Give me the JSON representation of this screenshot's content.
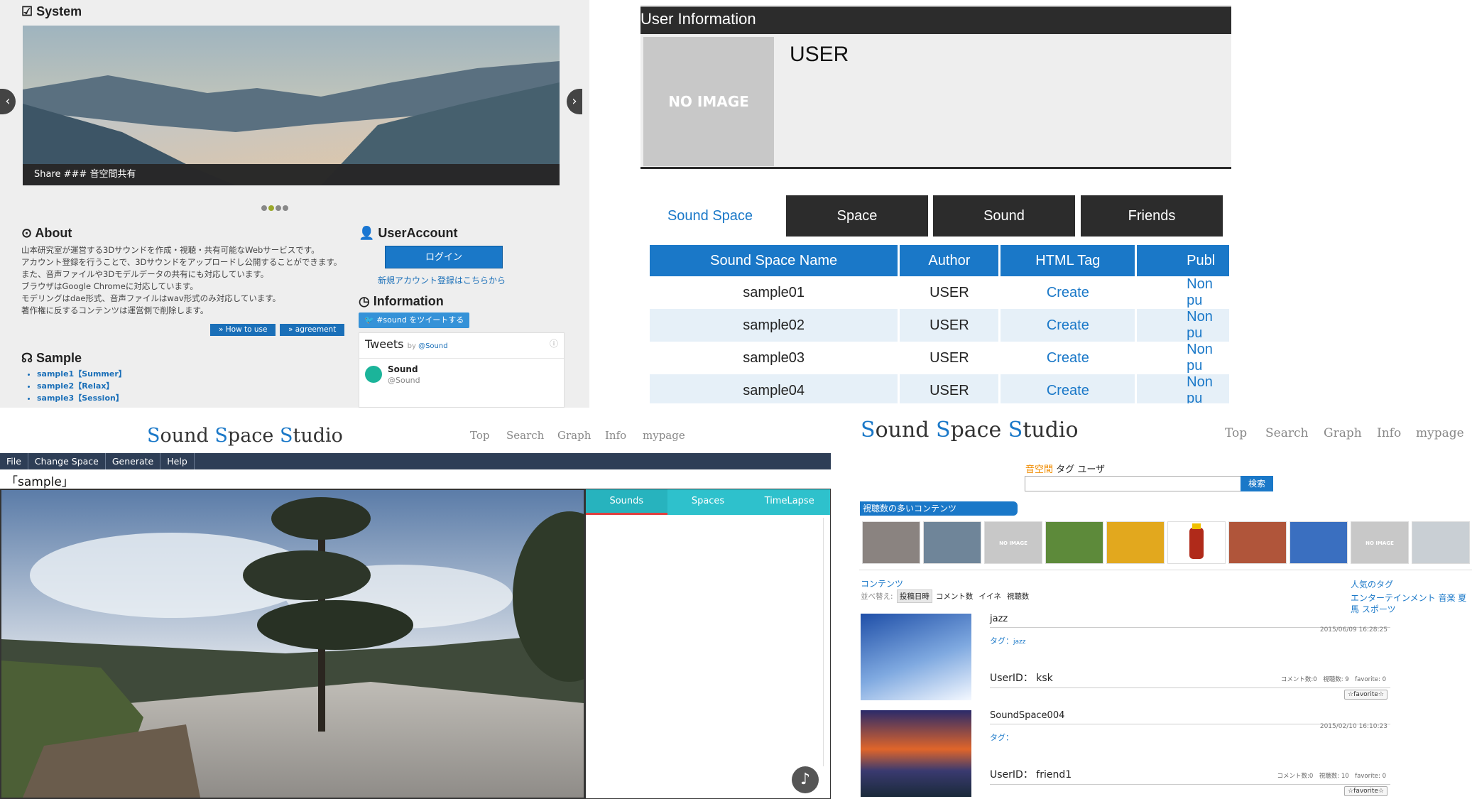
{
  "panel1": {
    "system_title": "System",
    "slide_caption": "Share ### 音空間共有",
    "about_title": "About",
    "about_lines": [
      "山本研究室が運営する3Dサウンドを作成・視聴・共有可能なWebサービスです。",
      "アカウント登録を行うことで、3Dサウンドをアップロードし公開することができます。",
      "また、音声ファイルや3Dモデルデータの共有にも対応しています。",
      "ブラウザはGoogle Chromeに対応しています。",
      "モデリングはdae形式、音声ファイルはwav形式のみ対応しています。",
      "著作権に反するコンテンツは運営側で削除します。"
    ],
    "howto_label": "How to use",
    "agreement_label": "agreement",
    "sample_title": "Sample",
    "samples": [
      "sample1【Summer】",
      "sample2【Relax】",
      "sample3【Session】"
    ],
    "useraccount_title": "UserAccount",
    "login_label": "ログイン",
    "register_link": "新規アカウント登録はこちらから",
    "information_title": "Information",
    "tweet_button": "#sound をツイートする",
    "tweets_label": "Tweets",
    "tweets_by": "by",
    "tweets_handle": "@Sound",
    "tweet_name": "Sound",
    "tweet_user": "@Sound"
  },
  "panel2": {
    "header": "User Information",
    "noimage": "NO IMAGE",
    "username": "USER",
    "tabs": [
      "Sound Space",
      "Space",
      "Sound",
      "Friends"
    ],
    "columns": [
      "Sound Space Name",
      "Author",
      "HTML Tag",
      "Publ"
    ],
    "rows": [
      {
        "name": "sample01",
        "author": "USER",
        "tag": "Create",
        "pub": "Non pu"
      },
      {
        "name": "sample02",
        "author": "USER",
        "tag": "Create",
        "pub": "Non pu"
      },
      {
        "name": "sample03",
        "author": "USER",
        "tag": "Create",
        "pub": "Non pu"
      },
      {
        "name": "sample04",
        "author": "USER",
        "tag": "Create",
        "pub": "Non pu"
      }
    ]
  },
  "logo": {
    "s1": "S",
    "w1": "ound ",
    "s2": "S",
    "w2": "pace ",
    "s3": "S",
    "w3": "tudio"
  },
  "nav": [
    "Top",
    "Search",
    "Graph",
    "Info",
    "mypage"
  ],
  "panel3": {
    "menu": [
      "File",
      "Change Space",
      "Generate",
      "Help"
    ],
    "space_name": "「sample」",
    "side_tabs": [
      "Sounds",
      "Spaces",
      "TimeLapse"
    ],
    "music_icon": "♪"
  },
  "panel4": {
    "search_tabs": [
      "音空間",
      "タグ",
      "ユーザ"
    ],
    "search_button": "検索",
    "popular_label": "視聴数の多いコンテンツ",
    "noimage": "NO IMAGE",
    "contents_label": "コンテンツ",
    "sort_label": "並べ替え:",
    "sort_options": [
      "投稿日時",
      "コメント数",
      "イイネ",
      "視聴数"
    ],
    "popular_tags_label": "人気のタグ",
    "popular_tags": "エンターテインメント 音楽 夏 馬 スポーツ",
    "items": [
      {
        "title": "jazz",
        "date": "2015/06/09 16:28:25",
        "tag_label": "タグ：",
        "tag": "jazz",
        "uid": "UserID： ksk",
        "counts": "コメント数:0　視聴数: 9　favorite: 0",
        "fav": "☆favorite☆"
      },
      {
        "title": "SoundSpace004",
        "date": "2015/02/10 16:10:23",
        "tag_label": "タグ：",
        "tag": "",
        "uid": "UserID： friend1",
        "counts": "コメント数:0　視聴数: 10　favorite: 0",
        "fav": "☆favorite☆"
      }
    ]
  },
  "colors": {
    "accent": "#1a78c8",
    "dark": "#2c2c2c",
    "teal": "#2ec1cc",
    "menubar": "#2e3e56"
  }
}
